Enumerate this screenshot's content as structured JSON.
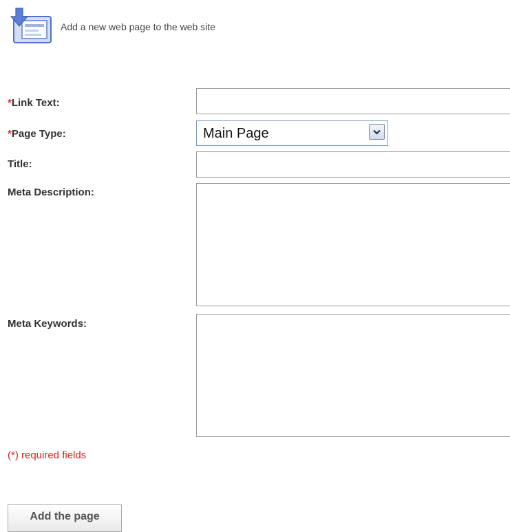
{
  "header": {
    "icon": "add-page-icon",
    "text": "Add a new web page to the web site"
  },
  "form": {
    "required_marker": "*",
    "link_text": {
      "label": "Link Text:",
      "value": ""
    },
    "page_type": {
      "label": "Page Type:",
      "selected": "Main Page",
      "icon": "chevron-down-icon"
    },
    "title": {
      "label": "Title:",
      "value": ""
    },
    "meta_description": {
      "label": "Meta Description:",
      "value": ""
    },
    "meta_keywords": {
      "label": "Meta Keywords:",
      "value": ""
    },
    "required_note": "(*) required fields",
    "submit_label": "Add the page"
  },
  "colors": {
    "required_red": "#e0201b",
    "label_text": "#333333",
    "field_border": "#9a9a9a",
    "icon_blue": "#5b7fd6"
  }
}
